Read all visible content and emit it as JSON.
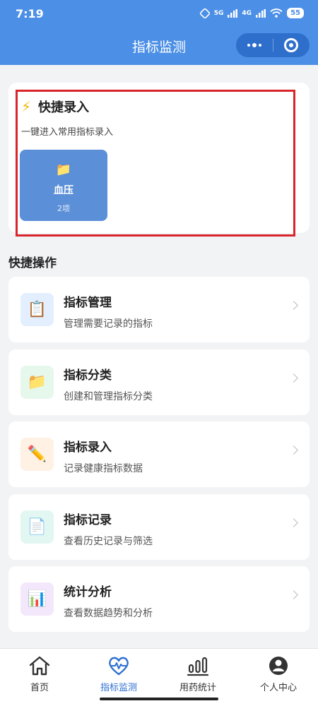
{
  "status_bar": {
    "time": "7:19",
    "network_5g": "5G",
    "network_4g": "4G",
    "battery": "55"
  },
  "nav": {
    "title": "指标监测"
  },
  "quick_entry": {
    "title": "快捷录入",
    "subtitle": "一键进入常用指标录入",
    "tile": {
      "name": "血压",
      "count": "2项",
      "icon": "folder-icon"
    }
  },
  "section_title": "快捷操作",
  "actions": [
    {
      "name": "指标管理",
      "desc": "管理需要记录的指标",
      "icon": "clipboard-icon",
      "icon_bg": "#e3efff"
    },
    {
      "name": "指标分类",
      "desc": "创建和管理指标分类",
      "icon": "folder-icon",
      "icon_bg": "#e6f7ec"
    },
    {
      "name": "指标录入",
      "desc": "记录健康指标数据",
      "icon": "pencil-icon",
      "icon_bg": "#fff1e3"
    },
    {
      "name": "指标记录",
      "desc": "查看历史记录与筛选",
      "icon": "document-icon",
      "icon_bg": "#e2f7f2"
    },
    {
      "name": "统计分析",
      "desc": "查看数据趋势和分析",
      "icon": "bar-chart-icon",
      "icon_bg": "#f3e8fb"
    }
  ],
  "tabs": [
    {
      "label": "首页",
      "icon": "home-icon",
      "active": false
    },
    {
      "label": "指标监测",
      "icon": "heart-pulse-icon",
      "active": true
    },
    {
      "label": "用药统计",
      "icon": "bar-chart-icon",
      "active": false
    },
    {
      "label": "个人中心",
      "icon": "person-icon",
      "active": false
    }
  ],
  "colors": {
    "header": "#4c8fe6",
    "tile": "#5b8fd8",
    "highlight_border": "#d9242b",
    "tab_active": "#2e6fd0"
  }
}
